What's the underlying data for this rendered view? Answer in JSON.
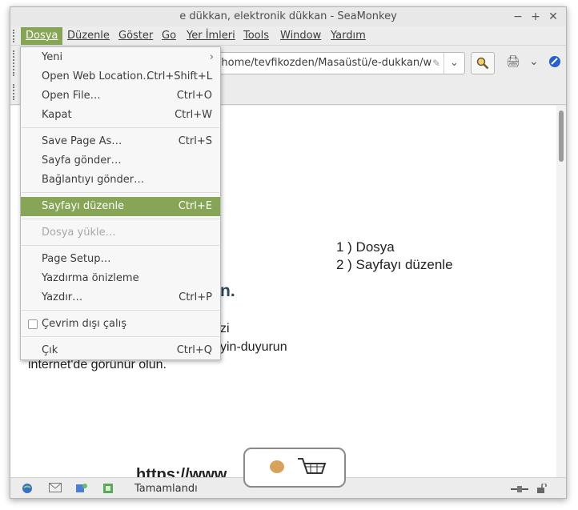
{
  "window": {
    "title": "e dükkan, elektronik dükkan - SeaMonkey",
    "controls": [
      "−",
      "+",
      "✕"
    ]
  },
  "menubar": [
    {
      "label": "Dosya"
    },
    {
      "label": "Düzenle"
    },
    {
      "label": "Göster"
    },
    {
      "label": "Go"
    },
    {
      "label": "Yer İmleri"
    },
    {
      "label": "Tools"
    },
    {
      "label": "Window"
    },
    {
      "label": "Yardım"
    }
  ],
  "navbar": {
    "url": "/home/tevfikozden/Masaüstü/e-dukkan/w"
  },
  "dropdown": [
    {
      "label": "Yeni",
      "shortcut": ""
    },
    {
      "label": "Open Web Location…",
      "shortcut": "Ctrl+Shift+L"
    },
    {
      "label": "Open File…",
      "shortcut": "Ctrl+O"
    },
    {
      "label": "Kapat",
      "shortcut": "Ctrl+W"
    },
    {
      "label": "Save Page As…",
      "shortcut": "Ctrl+S"
    },
    {
      "label": "Sayfa gönder…",
      "shortcut": ""
    },
    {
      "label": "Bağlantıyı gönder…",
      "shortcut": ""
    },
    {
      "label": "Sayfayı düzenle",
      "shortcut": "Ctrl+E"
    },
    {
      "label": "Dosya yükle…",
      "shortcut": ""
    },
    {
      "label": "Page Setup…",
      "shortcut": ""
    },
    {
      "label": "Yazdırma önizleme",
      "shortcut": ""
    },
    {
      "label": "Yazdır…",
      "shortcut": "Ctrl+P"
    },
    {
      "label": "Çevrim dışı çalış",
      "shortcut": ""
    },
    {
      "label": "Çık",
      "shortcut": "Ctrl+Q"
    }
  ],
  "content": {
    "note1": "1 ) Dosya",
    "note2": "2 ) Sayfayı düzenle",
    "frag1": "n.",
    "frag2": "zi",
    "frag3": "yin-duyurun",
    "frag4": "internet'de görünür olun.",
    "frag5": "https://www"
  },
  "status": {
    "text": "Tamamlandı"
  }
}
